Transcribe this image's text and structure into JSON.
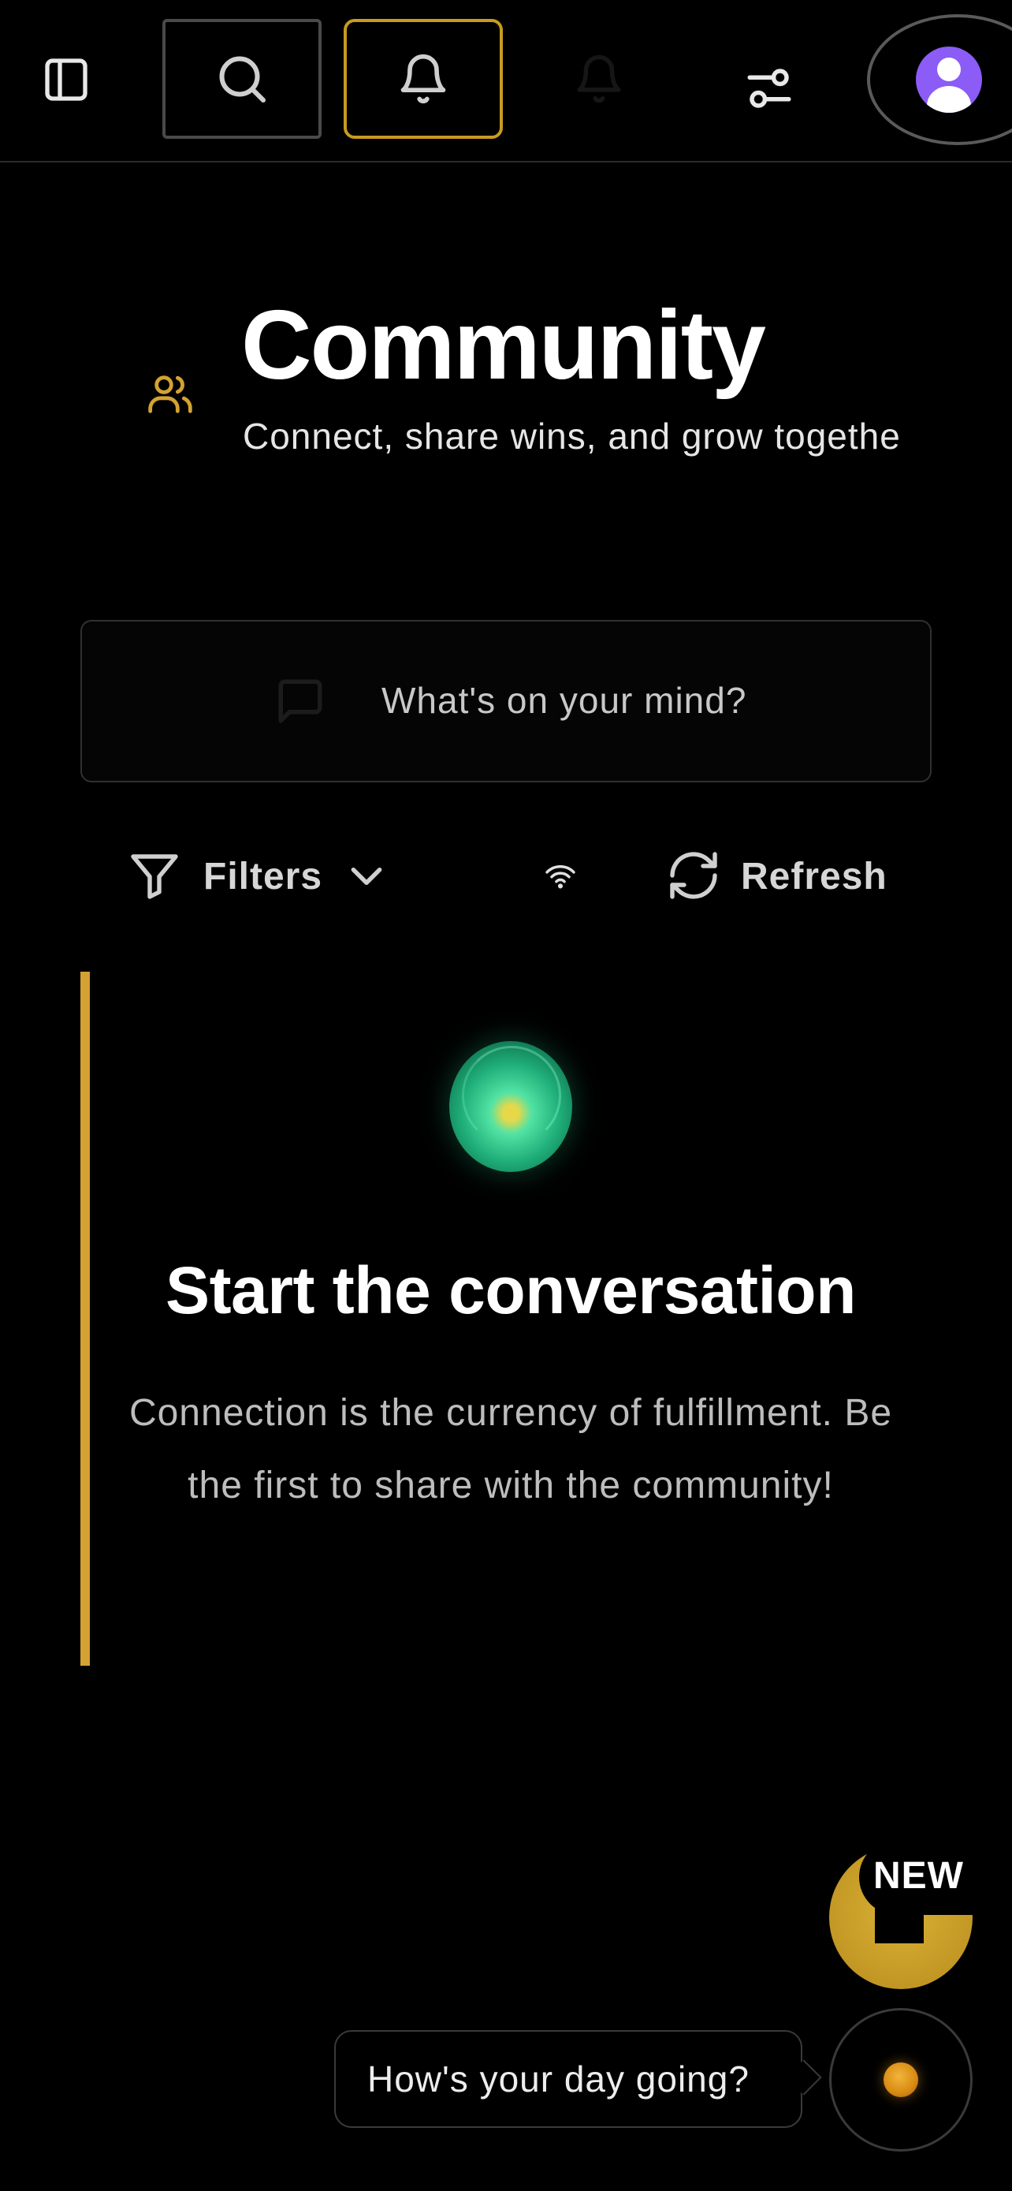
{
  "header": {
    "icons": {
      "sidebar": "sidebar-toggle-icon",
      "search": "search-icon",
      "notifications": "bell-icon",
      "ghost_notifications": "bell-icon",
      "settings": "sliders-icon",
      "profile": "user-avatar-icon"
    }
  },
  "page": {
    "icon": "users-icon",
    "title": "Community",
    "subtitle": "Connect, share wins, and grow togethe"
  },
  "composer": {
    "icon": "chat-bubble-icon",
    "placeholder": "What's on your mind?"
  },
  "toolbar": {
    "filters_label": "Filters",
    "refresh_label": "Refresh",
    "connection_icon": "wifi-icon"
  },
  "empty_state": {
    "title": "Start the conversation",
    "body": "Connection is the currency of fulfillment. Be the first to share with the community!"
  },
  "widgets": {
    "new_badge": "NEW",
    "chat_prompt": "How's your day going?"
  },
  "colors": {
    "background": "#000000",
    "accent_gold": "#d4a231",
    "notification_border": "#c99a22",
    "avatar_purple": "#8b5cf6",
    "orb_green": "#1fae79"
  }
}
